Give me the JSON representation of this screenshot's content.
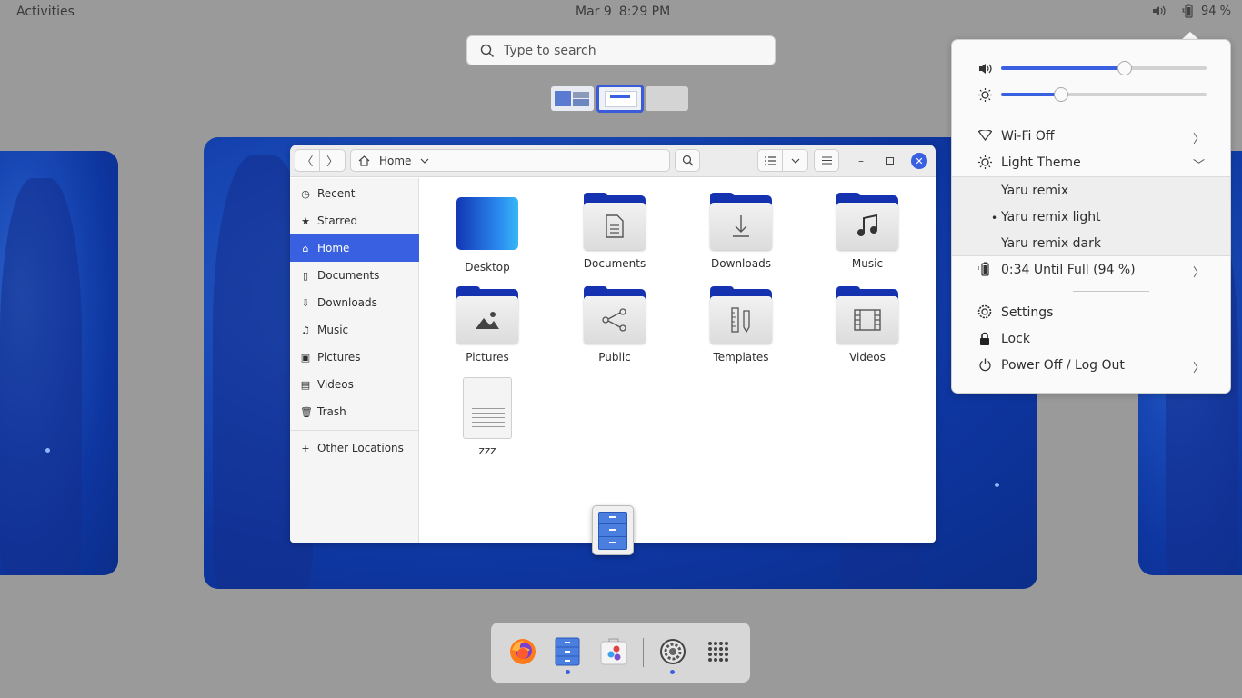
{
  "topbar": {
    "activities": "Activities",
    "date": "Mar 9",
    "time": "8:29 PM",
    "battery": "94 %",
    "icons": [
      "volume-icon",
      "battery-icon"
    ]
  },
  "search": {
    "placeholder": "Type to search"
  },
  "file_manager": {
    "location": "Home",
    "sidebar": [
      {
        "label": "Recent",
        "icon": "clock-icon"
      },
      {
        "label": "Starred",
        "icon": "star-icon"
      },
      {
        "label": "Home",
        "icon": "home-icon",
        "active": true
      },
      {
        "label": "Documents",
        "icon": "document-icon"
      },
      {
        "label": "Downloads",
        "icon": "download-icon"
      },
      {
        "label": "Music",
        "icon": "music-icon"
      },
      {
        "label": "Pictures",
        "icon": "picture-icon"
      },
      {
        "label": "Videos",
        "icon": "video-icon"
      },
      {
        "label": "Trash",
        "icon": "trash-icon"
      },
      {
        "label": "Other Locations",
        "icon": "plus-icon"
      }
    ],
    "items": [
      {
        "label": "Desktop"
      },
      {
        "label": "Documents"
      },
      {
        "label": "Downloads"
      },
      {
        "label": "Music"
      },
      {
        "label": "Pictures"
      },
      {
        "label": "Public"
      },
      {
        "label": "Templates"
      },
      {
        "label": "Videos"
      },
      {
        "label": "zzz"
      }
    ]
  },
  "quick_settings": {
    "volume_level": 0.6,
    "brightness_level": 0.29,
    "wifi": "Wi-Fi Off",
    "theme": "Light Theme",
    "theme_options": [
      "Yaru remix",
      "Yaru remix light",
      "Yaru remix dark"
    ],
    "theme_selected": "Yaru remix light",
    "battery": "0:34 Until Full (94 %)",
    "settings": "Settings",
    "lock": "Lock",
    "power": "Power Off / Log Out"
  },
  "dock": {
    "apps": [
      "firefox-icon",
      "files-icon",
      "software-icon",
      "settings-icon",
      "app-grid-icon"
    ],
    "running": [
      "files-icon",
      "settings-icon"
    ]
  },
  "colors": {
    "accent": "#3860e0",
    "wallpaper": "#1848b5"
  }
}
